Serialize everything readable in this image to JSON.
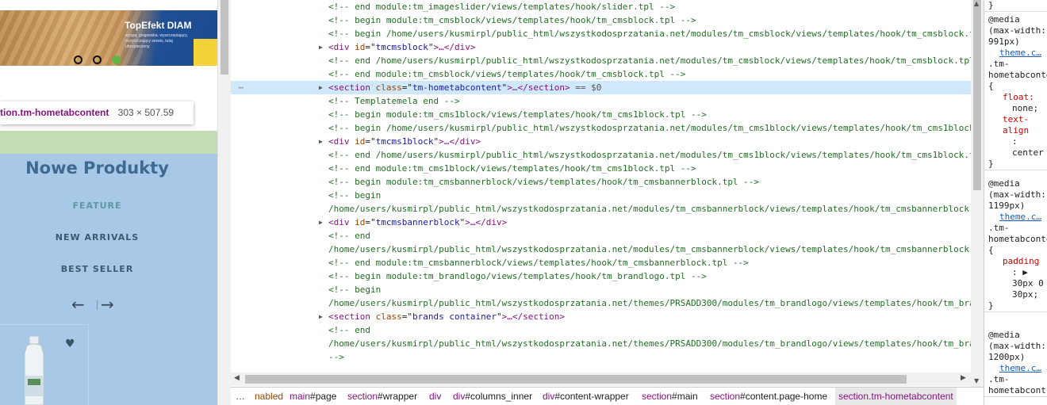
{
  "preview": {
    "slider": {
      "logo": "TopEfekt DIAM",
      "subtitle": "wyspa, głogowska, wyszczepiający, oczyszczający serwis, tutaj ubezpieczony"
    },
    "tooltip": {
      "selector": "tion.tm-hometabcontent",
      "dimensions": "303 × 507.59"
    },
    "heading": "Nowe Produkty",
    "tabs": [
      "FEATURE",
      "NEW ARRIVALS",
      "BEST SELLER"
    ],
    "arrow_prev": "←",
    "arrow_next": "→",
    "heart": "♥"
  },
  "elements": {
    "rows": [
      {
        "kind": "comment",
        "text": "<!-- end module:tm_imageslider/views/templates/hook/slider.tpl -->"
      },
      {
        "kind": "comment",
        "text": "<!-- begin module:tm_cmsblock/views/templates/hook/tm_cmsblock.tpl -->"
      },
      {
        "kind": "comment",
        "text": "<!-- begin /home/users/kusmirpl/public_html/wszystkodosprzatania.net/modules/tm_cmsblock/views/templates/hook/tm_cmsblock.t"
      },
      {
        "kind": "tag",
        "tag": "div",
        "attr": "id",
        "value": "tmcmsblock",
        "close": "…</div>"
      },
      {
        "kind": "comment",
        "text": "<!-- end /home/users/kusmirpl/public_html/wszystkodosprzatania.net/modules/tm_cmsblock/views/templates/hook/tm_cmsblock.tpl"
      },
      {
        "kind": "comment",
        "text": "<!-- end module:tm_cmsblock/views/templates/hook/tm_cmsblock.tpl -->"
      },
      {
        "kind": "tag",
        "tag": "section",
        "attr": "class",
        "value": "tm-hometabcontent",
        "close": "…</section>",
        "suffix": " == $0",
        "selected": true
      },
      {
        "kind": "comment",
        "text": "<!-- Templatemela end -->"
      },
      {
        "kind": "comment",
        "text": "<!-- begin module:tm_cms1block/views/templates/hook/tm_cms1block.tpl -->"
      },
      {
        "kind": "comment",
        "text": "<!-- begin /home/users/kusmirpl/public_html/wszystkodosprzatania.net/modules/tm_cms1block/views/templates/hook/tm_cms1block"
      },
      {
        "kind": "tag",
        "tag": "div",
        "attr": "id",
        "value": "tmcms1block",
        "close": "…</div>"
      },
      {
        "kind": "comment",
        "text": "<!-- end /home/users/kusmirpl/public_html/wszystkodosprzatania.net/modules/tm_cms1block/views/templates/hook/tm_cms1block.t"
      },
      {
        "kind": "comment",
        "text": "<!-- end module:tm_cms1block/views/templates/hook/tm_cms1block.tpl -->"
      },
      {
        "kind": "comment",
        "text": "<!-- begin module:tm_cmsbannerblock/views/templates/hook/tm_cmsbannerblock.tpl -->"
      },
      {
        "kind": "comment",
        "text": "<!-- begin"
      },
      {
        "kind": "comment",
        "text": "/home/users/kusmirpl/public_html/wszystkodosprzatania.net/modules/tm_cmsbannerblock/views/templates/hook/tm_cmsbannerblock."
      },
      {
        "kind": "tag",
        "tag": "div",
        "attr": "id",
        "value": "tmcmsbannerblock",
        "close": "…</div>"
      },
      {
        "kind": "comment",
        "text": "<!-- end"
      },
      {
        "kind": "comment",
        "text": "/home/users/kusmirpl/public_html/wszystkodosprzatania.net/modules/tm_cmsbannerblock/views/templates/hook/tm_cmsbannerblock."
      },
      {
        "kind": "comment",
        "text": "<!-- end module:tm_cmsbannerblock/views/templates/hook/tm_cmsbannerblock.tpl -->"
      },
      {
        "kind": "comment",
        "text": "<!-- begin module:tm_brandlogo/views/templates/hook/tm_brandlogo.tpl -->"
      },
      {
        "kind": "comment",
        "text": "<!-- begin"
      },
      {
        "kind": "comment",
        "text": "/home/users/kusmirpl/public_html/wszystkodosprzatania.net/themes/PRSADD300/modules/tm_brandlogo/views/templates/hook/tm_bra"
      },
      {
        "kind": "tag",
        "tag": "section",
        "attr": "class",
        "value": "brands container",
        "close": "…</section>"
      },
      {
        "kind": "comment",
        "text": "<!-- end"
      },
      {
        "kind": "comment",
        "text": "/home/users/kusmirpl/public_html/wszystkodosprzatania.net/themes/PRSADD300/modules/tm_brandlogo/views/templates/hook/tm_bra"
      },
      {
        "kind": "comment",
        "text": "-->"
      }
    ]
  },
  "breadcrumbs": {
    "more": "…",
    "items": [
      {
        "tag": "",
        "rest": "nabled"
      },
      {
        "tag": "main",
        "rest": "#page"
      },
      {
        "tag": "section",
        "rest": "#wrapper"
      },
      {
        "tag": "div",
        "rest": ""
      },
      {
        "tag": "div",
        "rest": "#columns_inner"
      },
      {
        "tag": "div",
        "rest": "#content-wrapper"
      },
      {
        "tag": "section",
        "rest": "#main"
      },
      {
        "tag": "section",
        "rest": "#content.page-home"
      },
      {
        "tag": "section.tm-hometabcontent",
        "rest": "",
        "active": true
      }
    ]
  },
  "styles": {
    "rules": [
      {
        "lines": [
          "}"
        ]
      },
      {
        "media": "@media (max-width: 991px)",
        "link": "theme.c…",
        "selector": ".tm-hometabcontent {",
        "props": [
          [
            "float:",
            "none;"
          ],
          [
            "text-align",
            ": center"
          ]
        ],
        "end": "}"
      },
      {
        "media": "@media (max-width: 1199px)",
        "link": "theme.c…",
        "selector": ".tm-hometabcontent {",
        "props": [
          [
            "padding",
            ": ▶ 30px 0 30px;"
          ]
        ],
        "end": "}"
      },
      {
        "media": "@media (max-width: 1200px)",
        "link": "theme.c…",
        "selector": ".tm-hometabcont",
        "props": [],
        "end": ""
      }
    ]
  },
  "colors": {
    "selected_row": "#cfe8fc",
    "comment": "#236e25",
    "tag": "#881280",
    "attr_name": "#994500",
    "attr_value": "#1a1aa6"
  }
}
